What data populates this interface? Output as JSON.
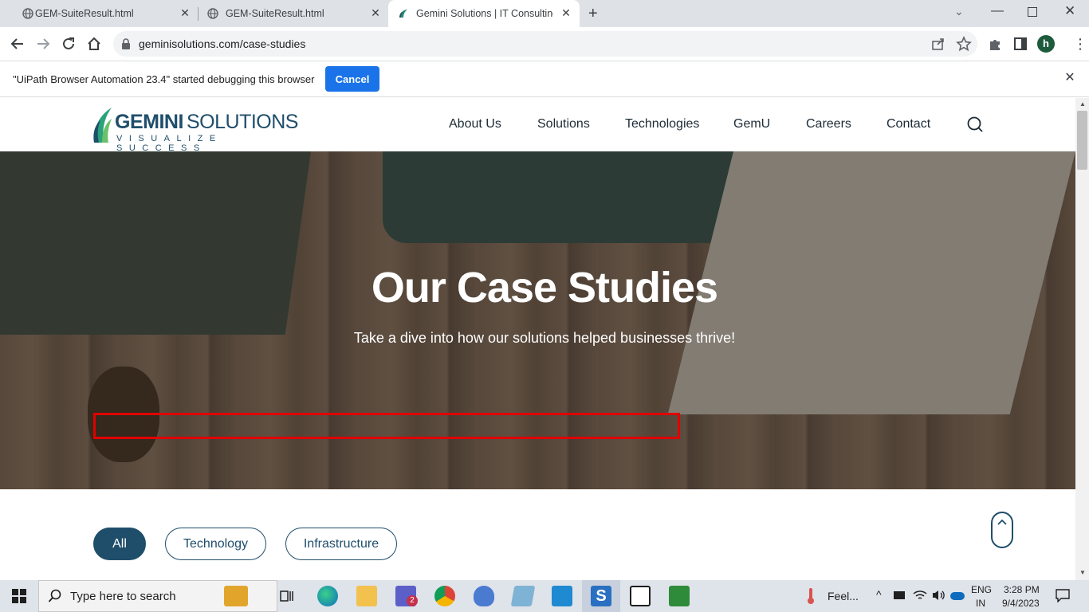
{
  "browser": {
    "tabs": [
      {
        "label": "GEM-SuiteResult.html",
        "active": false
      },
      {
        "label": "GEM-SuiteResult.html",
        "active": false
      },
      {
        "label": "Gemini Solutions | IT Consulting,",
        "active": true
      }
    ],
    "new_tab": "+",
    "url": "geminisolutions.com/case-studies",
    "profile_initial": "h"
  },
  "infobar": {
    "message": "\"UiPath Browser Automation 23.4\" started debugging this browser",
    "cancel_label": "Cancel"
  },
  "site": {
    "logo_main_1": "GEMINI",
    "logo_main_2": "SOLUTIONS",
    "logo_tagline": "VISUALIZE SUCCESS",
    "nav": [
      "About Us",
      "Solutions",
      "Technologies",
      "GemU",
      "Careers",
      "Contact"
    ],
    "hero_title": "Our Case Studies",
    "hero_subtitle": "Take a dive into how our solutions helped businesses thrive!",
    "filters": [
      {
        "label": "All",
        "active": true
      },
      {
        "label": "Technology",
        "active": false
      },
      {
        "label": "Infrastructure",
        "active": false
      }
    ]
  },
  "taskbar": {
    "search_placeholder": "Type here to search",
    "weather": "Feel...",
    "lang_1": "ENG",
    "lang_2": "IN",
    "time": "3:28 PM",
    "date": "9/4/2023",
    "teams_badge": "2"
  },
  "colors": {
    "accent": "#1f4e6b",
    "chrome_blue": "#1a73e8",
    "highlight_red": "#e00000"
  }
}
